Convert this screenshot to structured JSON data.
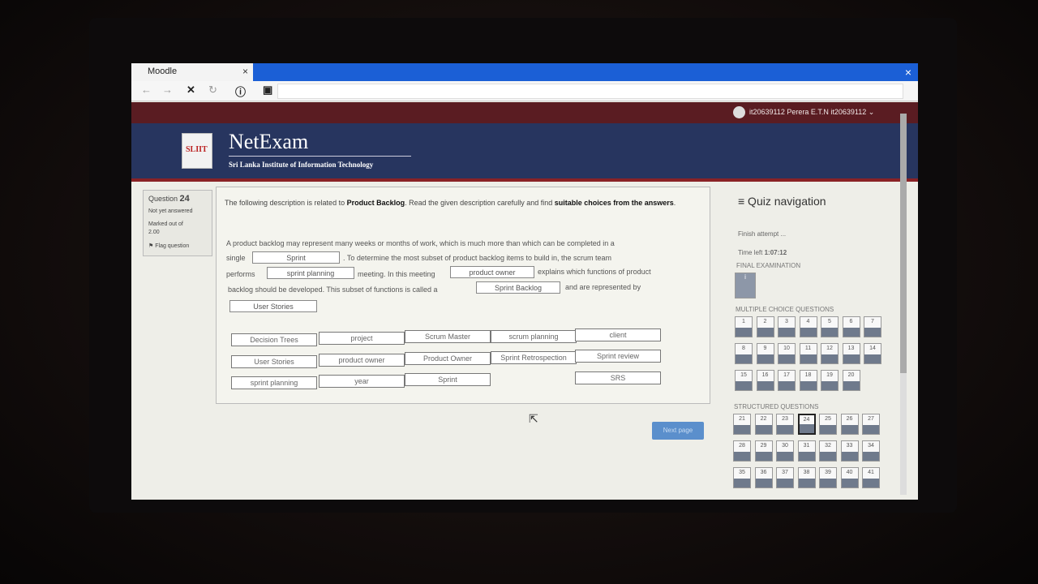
{
  "browser": {
    "tab_title": "Moodle",
    "tab_close": "×",
    "window_close": "×",
    "nav": {
      "back": "←",
      "forward": "→",
      "stop": "✕",
      "reload": "↻",
      "info": "ⓘ",
      "page": "▣"
    }
  },
  "user": {
    "name": "it20639112 Perera E.T.N it20639112",
    "menu": "⌄"
  },
  "brand": {
    "name": "NetExam",
    "subtitle": "Sri Lanka Institute of Information Technology",
    "logo_text": "SLIIT"
  },
  "question_info": {
    "label": "Question",
    "number": "24",
    "status": "Not yet answered",
    "marked_out_of": "Marked out of",
    "marks": "2.00",
    "flag": "Flag question"
  },
  "question": {
    "intro_a": "The following description is related to ",
    "intro_bold1": "Product Backlog",
    "intro_b": ". Read the given description carefully and find ",
    "intro_bold2": "suitable choices from the answers",
    "intro_c": ".",
    "l1": "A product backlog may represent many weeks or months of work, which is much more than which can be completed in a",
    "l2a": "single",
    "l2b": ". To determine the most subset of product backlog items to build in, the scrum team",
    "l3a": "performs",
    "l3b": "meeting. In this meeting",
    "l3c": "explains which functions of product",
    "l4a": "backlog should be developed. This subset of functions is called a",
    "l4b": "and are represented by",
    "drops": [
      "Sprint",
      "sprint planning",
      "product owner",
      "Sprint Backlog",
      "User Stories"
    ],
    "options": [
      "Decision Trees",
      "project",
      "Scrum Master",
      "scrum planning",
      "client",
      "User Stories",
      "product owner",
      "Product Owner",
      "Sprint Retrospection",
      "Sprint review",
      "sprint planning",
      "year",
      "Sprint",
      "SRS"
    ],
    "next_button": "Next page"
  },
  "quiz_nav": {
    "title": "≡ Quiz navigation",
    "finish": "Finish attempt ...",
    "time_label": "Time left ",
    "time_value": "1:07:12",
    "final_label": "FINAL EXAMINATION",
    "info_label": "i",
    "mcq_label": "MULTIPLE CHOICE QUESTIONS",
    "structured_label": "STRUCTURED QUESTIONS",
    "mcq": [
      "1",
      "2",
      "3",
      "4",
      "5",
      "6",
      "7",
      "8",
      "9",
      "10",
      "11",
      "12",
      "13",
      "14",
      "15",
      "16",
      "17",
      "18",
      "19",
      "20"
    ],
    "structured": [
      "21",
      "22",
      "23",
      "24",
      "25",
      "26",
      "27",
      "28",
      "29",
      "30",
      "31",
      "32",
      "33",
      "34",
      "35",
      "36",
      "37",
      "38",
      "39",
      "40",
      "41"
    ],
    "current": "24"
  }
}
